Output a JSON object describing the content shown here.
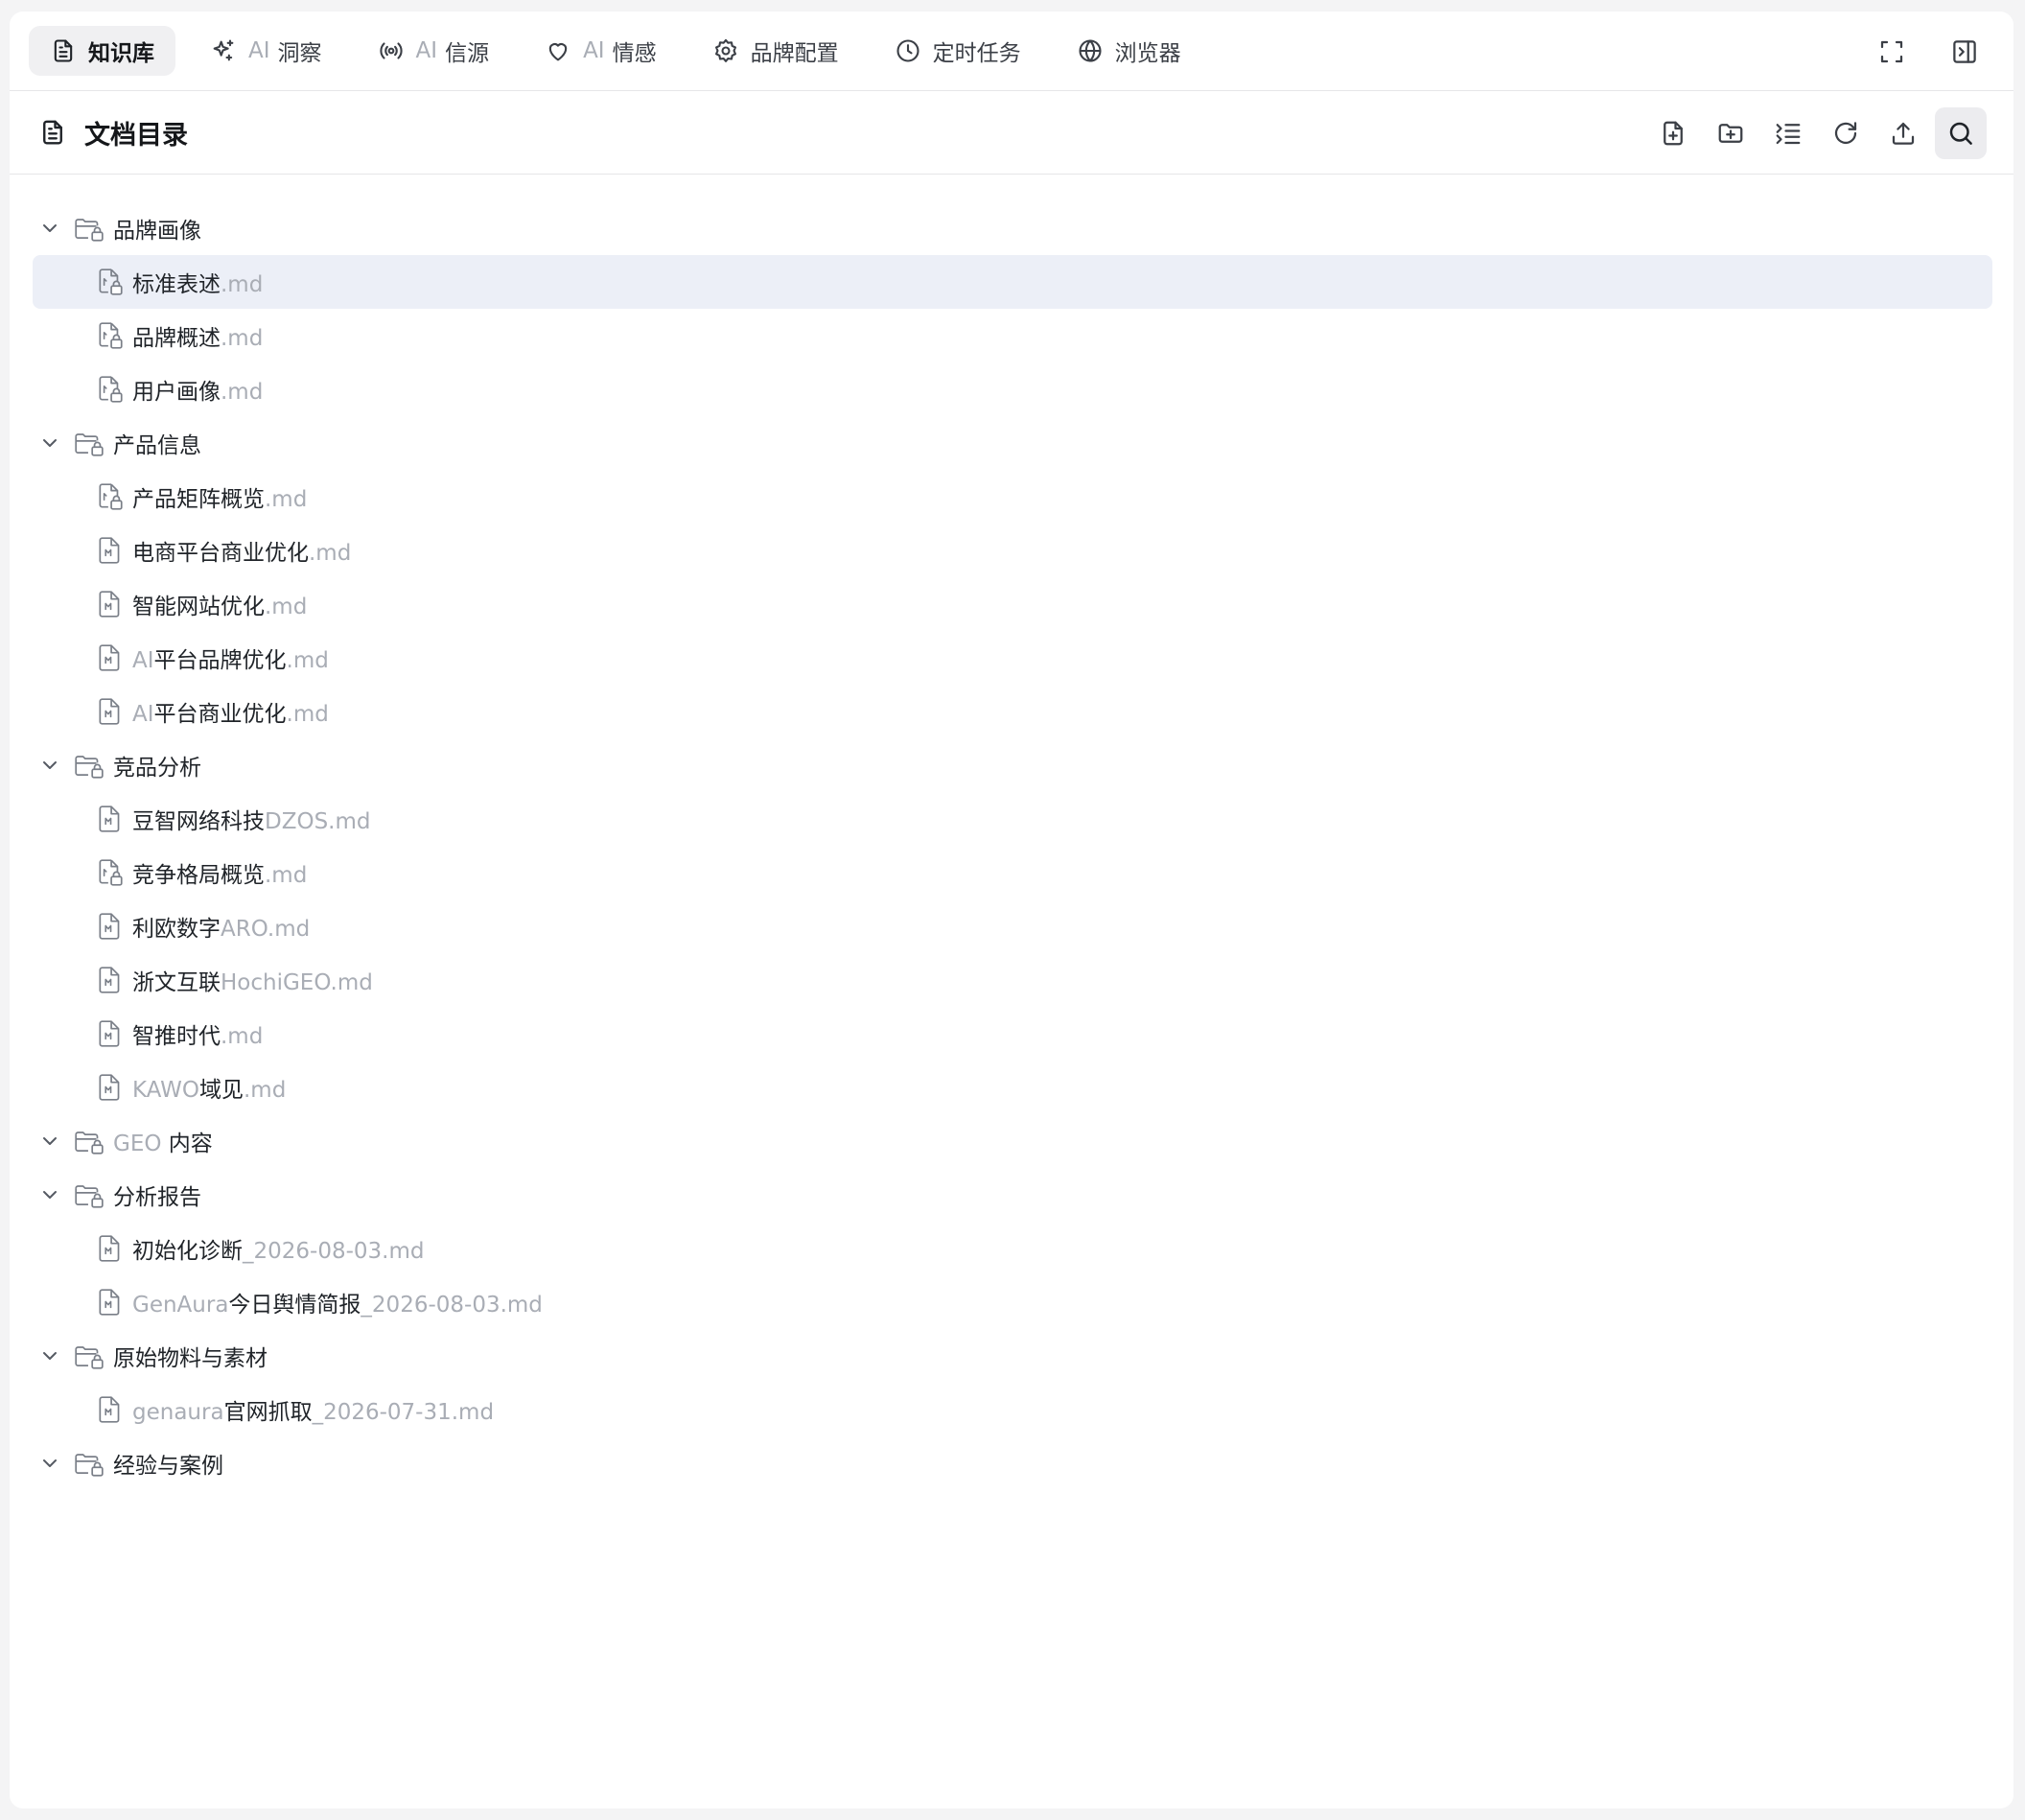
{
  "tabs": [
    {
      "ai": "",
      "label": "知识库",
      "icon": "document-icon",
      "active": true
    },
    {
      "ai": "AI",
      "label": "洞察",
      "icon": "sparkles-icon",
      "active": false
    },
    {
      "ai": "AI",
      "label": "信源",
      "icon": "broadcast-icon",
      "active": false
    },
    {
      "ai": "AI",
      "label": "情感",
      "icon": "heart-icon",
      "active": false
    },
    {
      "ai": "",
      "label": "品牌配置",
      "icon": "gear-icon",
      "active": false
    },
    {
      "ai": "",
      "label": "定时任务",
      "icon": "clock-icon",
      "active": false
    },
    {
      "ai": "",
      "label": "浏览器",
      "icon": "globe-icon",
      "active": false
    }
  ],
  "header": {
    "title": "文档目录"
  },
  "tree": [
    {
      "type": "folder",
      "parts": [
        {
          "t": "品牌画像",
          "dim": false
        }
      ]
    },
    {
      "type": "file",
      "icon": "locked",
      "selected": true,
      "parts": [
        {
          "t": "标准表述",
          "dim": false
        },
        {
          "t": ".md",
          "dim": true
        }
      ]
    },
    {
      "type": "file",
      "icon": "locked",
      "parts": [
        {
          "t": "品牌概述",
          "dim": false
        },
        {
          "t": ".md",
          "dim": true
        }
      ]
    },
    {
      "type": "file",
      "icon": "locked",
      "parts": [
        {
          "t": "用户画像",
          "dim": false
        },
        {
          "t": ".md",
          "dim": true
        }
      ]
    },
    {
      "type": "folder",
      "parts": [
        {
          "t": "产品信息",
          "dim": false
        }
      ]
    },
    {
      "type": "file",
      "icon": "locked",
      "parts": [
        {
          "t": "产品矩阵概览",
          "dim": false
        },
        {
          "t": ".md",
          "dim": true
        }
      ]
    },
    {
      "type": "file",
      "icon": "markdown",
      "parts": [
        {
          "t": "电商平台商业优化",
          "dim": false
        },
        {
          "t": ".md",
          "dim": true
        }
      ]
    },
    {
      "type": "file",
      "icon": "markdown",
      "parts": [
        {
          "t": "智能网站优化",
          "dim": false
        },
        {
          "t": ".md",
          "dim": true
        }
      ]
    },
    {
      "type": "file",
      "icon": "markdown",
      "parts": [
        {
          "t": "AI",
          "dim": true
        },
        {
          "t": "平台品牌优化",
          "dim": false
        },
        {
          "t": ".md",
          "dim": true
        }
      ]
    },
    {
      "type": "file",
      "icon": "markdown",
      "parts": [
        {
          "t": "AI",
          "dim": true
        },
        {
          "t": "平台商业优化",
          "dim": false
        },
        {
          "t": ".md",
          "dim": true
        }
      ]
    },
    {
      "type": "folder",
      "parts": [
        {
          "t": "竞品分析",
          "dim": false
        }
      ]
    },
    {
      "type": "file",
      "icon": "markdown",
      "parts": [
        {
          "t": "豆智网络科技",
          "dim": false
        },
        {
          "t": "DZOS.md",
          "dim": true
        }
      ]
    },
    {
      "type": "file",
      "icon": "locked",
      "parts": [
        {
          "t": "竞争格局概览",
          "dim": false
        },
        {
          "t": ".md",
          "dim": true
        }
      ]
    },
    {
      "type": "file",
      "icon": "markdown",
      "parts": [
        {
          "t": "利欧数字",
          "dim": false
        },
        {
          "t": "ARO.md",
          "dim": true
        }
      ]
    },
    {
      "type": "file",
      "icon": "markdown",
      "parts": [
        {
          "t": "浙文互联",
          "dim": false
        },
        {
          "t": "HochiGEO.md",
          "dim": true
        }
      ]
    },
    {
      "type": "file",
      "icon": "markdown",
      "parts": [
        {
          "t": "智推时代",
          "dim": false
        },
        {
          "t": ".md",
          "dim": true
        }
      ]
    },
    {
      "type": "file",
      "icon": "markdown",
      "parts": [
        {
          "t": "KAWO",
          "dim": true
        },
        {
          "t": "域见",
          "dim": false
        },
        {
          "t": ".md",
          "dim": true
        }
      ]
    },
    {
      "type": "folder",
      "parts": [
        {
          "t": "GEO ",
          "dim": true
        },
        {
          "t": "内容",
          "dim": false
        }
      ]
    },
    {
      "type": "folder",
      "parts": [
        {
          "t": "分析报告",
          "dim": false
        }
      ]
    },
    {
      "type": "file",
      "icon": "markdown",
      "parts": [
        {
          "t": "初始化诊断",
          "dim": false
        },
        {
          "t": "_2026-08-03.md",
          "dim": true
        }
      ]
    },
    {
      "type": "file",
      "icon": "markdown",
      "parts": [
        {
          "t": "GenAura",
          "dim": true
        },
        {
          "t": "今日舆情简报",
          "dim": false
        },
        {
          "t": "_2026-08-03.md",
          "dim": true
        }
      ]
    },
    {
      "type": "folder",
      "parts": [
        {
          "t": "原始物料与素材",
          "dim": false
        }
      ]
    },
    {
      "type": "file",
      "icon": "markdown",
      "parts": [
        {
          "t": "genaura",
          "dim": true
        },
        {
          "t": "官网抓取",
          "dim": false
        },
        {
          "t": "_2026-07-31.md",
          "dim": true
        }
      ]
    },
    {
      "type": "folder",
      "parts": [
        {
          "t": "经验与案例",
          "dim": false
        }
      ]
    }
  ],
  "colors": {
    "selected_row": "#eceff7",
    "active_tab": "#f0f0f2",
    "dim_text": "#a9adb5"
  }
}
